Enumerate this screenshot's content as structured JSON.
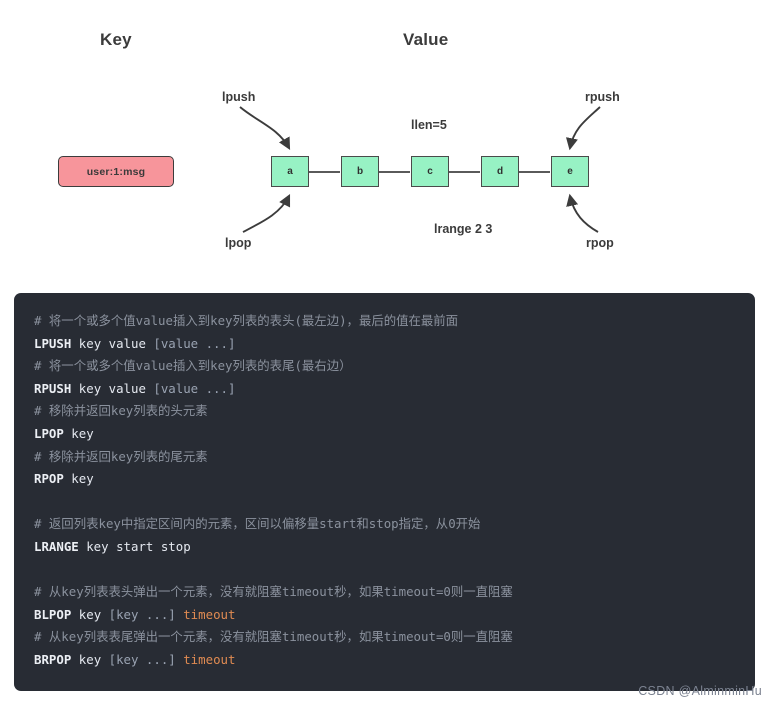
{
  "diagram": {
    "headings": {
      "key": "Key",
      "value": "Value"
    },
    "key_box": {
      "label": "user:1:msg",
      "fill": "#f7959b",
      "border": "#3c3c3c"
    },
    "nodes": [
      {
        "label": "a"
      },
      {
        "label": "b"
      },
      {
        "label": "c"
      },
      {
        "label": "d"
      },
      {
        "label": "e"
      }
    ],
    "node_fill": "#97f2c4",
    "node_border": "#4a4a4a",
    "annotations": {
      "lpush": "lpush",
      "rpush": "rpush",
      "llen": "llen=5",
      "lrange": "lrange 2 3",
      "lpop": "lpop",
      "rpop": "rpop"
    }
  },
  "code": {
    "background": "#282c34",
    "comment_color": "#8b929e",
    "command_color": "#eceff4",
    "arg_color": "#e08b52",
    "lines": [
      {
        "type": "comment",
        "text": "# 将一个或多个值value插入到key列表的表头(最左边)，最后的值在最前面"
      },
      {
        "type": "code",
        "cmd": "LPUSH",
        "args": " key value ",
        "brkt": "[value ...]",
        "tail": ""
      },
      {
        "type": "comment",
        "text": "# 将一个或多个值value插入到key列表的表尾(最右边）"
      },
      {
        "type": "code",
        "cmd": "RPUSH",
        "args": " key value ",
        "brkt": "[value ...]",
        "tail": ""
      },
      {
        "type": "comment",
        "text": "# 移除并返回key列表的头元素"
      },
      {
        "type": "code",
        "cmd": "LPOP",
        "args": " key",
        "brkt": "",
        "tail": ""
      },
      {
        "type": "comment",
        "text": "# 移除并返回key列表的尾元素"
      },
      {
        "type": "code",
        "cmd": "RPOP",
        "args": " key",
        "brkt": "",
        "tail": ""
      },
      {
        "type": "blank"
      },
      {
        "type": "comment",
        "text": "# 返回列表key中指定区间内的元素，区间以偏移量start和stop指定，从0开始"
      },
      {
        "type": "code",
        "cmd": "LRANGE",
        "args": " key start stop",
        "brkt": "",
        "tail": ""
      },
      {
        "type": "blank"
      },
      {
        "type": "comment",
        "text": "# 从key列表表头弹出一个元素，没有就阻塞timeout秒，如果timeout=0则一直阻塞"
      },
      {
        "type": "code",
        "cmd": "BLPOP",
        "args": " key ",
        "brkt": "[key ...]",
        "tail": " timeout"
      },
      {
        "type": "comment",
        "text": "# 从key列表表尾弹出一个元素，没有就阻塞timeout秒，如果timeout=0则一直阻塞"
      },
      {
        "type": "code",
        "cmd": "BRPOP",
        "args": " key ",
        "brkt": "[key ...]",
        "tail": " timeout"
      }
    ]
  },
  "watermark": {
    "text": "CSDN @AlminminHu"
  }
}
